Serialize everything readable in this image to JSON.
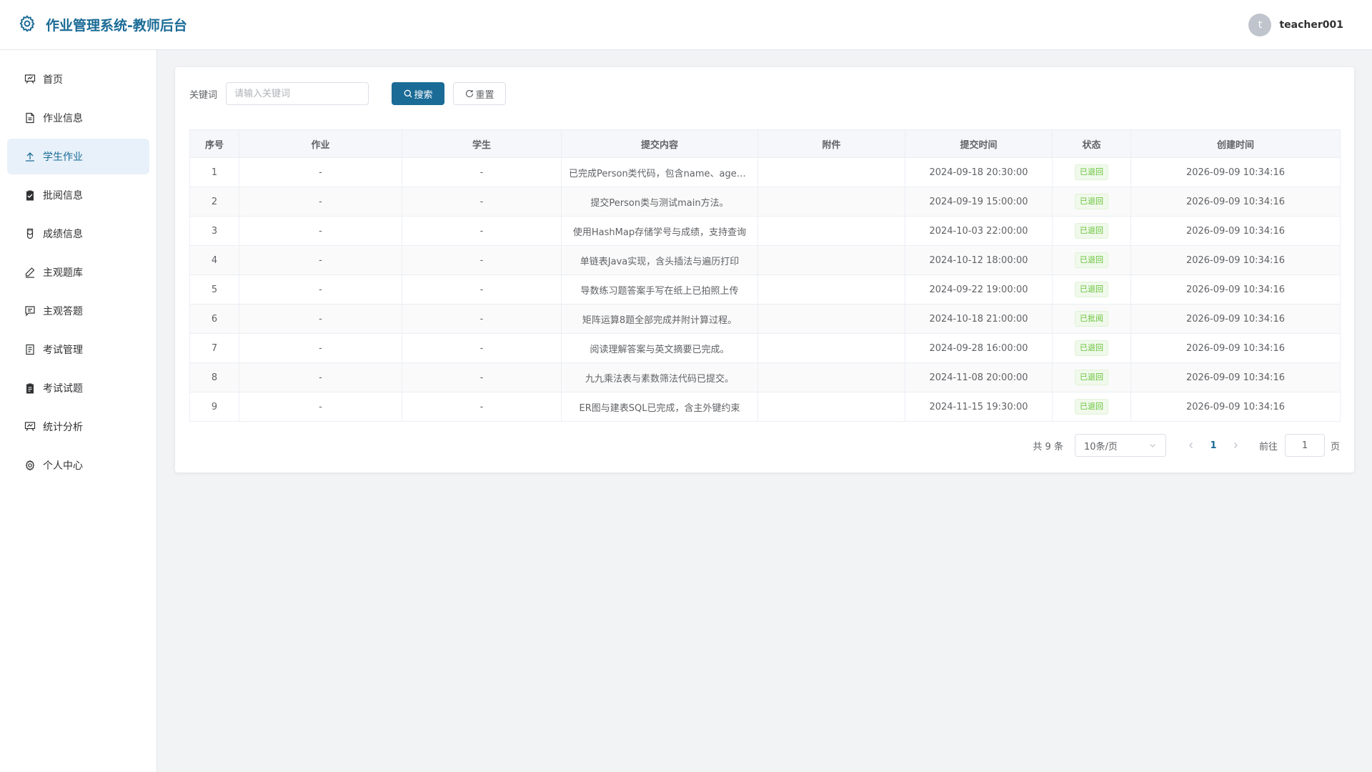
{
  "header": {
    "title": "作业管理系统-教师后台",
    "avatar_initial": "t",
    "username": "teacher001",
    "logo_icon": "gear-icon",
    "brand_color": "#1a6b96"
  },
  "sidebar": {
    "items": [
      {
        "label": "首页",
        "icon": "presentation-icon"
      },
      {
        "label": "作业信息",
        "icon": "document-icon"
      },
      {
        "label": "学生作业",
        "icon": "upload-icon",
        "active": true
      },
      {
        "label": "批阅信息",
        "icon": "clipboard-check-icon"
      },
      {
        "label": "成绩信息",
        "icon": "medal-icon"
      },
      {
        "label": "主观题库",
        "icon": "edit-pen-icon"
      },
      {
        "label": "主观答题",
        "icon": "chat-icon"
      },
      {
        "label": "考试管理",
        "icon": "tickets-icon"
      },
      {
        "label": "考试试题",
        "icon": "clipboard-icon"
      },
      {
        "label": "统计分析",
        "icon": "chart-board-icon"
      },
      {
        "label": "个人中心",
        "icon": "setting-icon"
      }
    ]
  },
  "search": {
    "label": "关键词",
    "placeholder": "请输入关键词",
    "value": "",
    "search_button": "搜索",
    "reset_button": "重置"
  },
  "table": {
    "columns": [
      "序号",
      "作业",
      "学生",
      "提交内容",
      "附件",
      "提交时间",
      "状态",
      "创建时间"
    ],
    "rows": [
      {
        "no": "1",
        "homework": "-",
        "student": "-",
        "content": "已完成Person类代码，包含name、age属性",
        "attachment": "",
        "submit_time": "2024-09-18 20:30:00",
        "status": "已退回",
        "created": "2026-09-09 10:34:16"
      },
      {
        "no": "2",
        "homework": "-",
        "student": "-",
        "content": "提交Person类与测试main方法。",
        "attachment": "",
        "submit_time": "2024-09-19 15:00:00",
        "status": "已退回",
        "created": "2026-09-09 10:34:16"
      },
      {
        "no": "3",
        "homework": "-",
        "student": "-",
        "content": "使用HashMap存储学号与成绩，支持查询",
        "attachment": "",
        "submit_time": "2024-10-03 22:00:00",
        "status": "已退回",
        "created": "2026-09-09 10:34:16"
      },
      {
        "no": "4",
        "homework": "-",
        "student": "-",
        "content": "单链表Java实现，含头插法与遍历打印",
        "attachment": "",
        "submit_time": "2024-10-12 18:00:00",
        "status": "已退回",
        "created": "2026-09-09 10:34:16"
      },
      {
        "no": "5",
        "homework": "-",
        "student": "-",
        "content": "导数练习题答案手写在纸上已拍照上传",
        "attachment": "",
        "submit_time": "2024-09-22 19:00:00",
        "status": "已退回",
        "created": "2026-09-09 10:34:16"
      },
      {
        "no": "6",
        "homework": "-",
        "student": "-",
        "content": "矩阵运算8题全部完成并附计算过程。",
        "attachment": "",
        "submit_time": "2024-10-18 21:00:00",
        "status": "已批阅",
        "created": "2026-09-09 10:34:16"
      },
      {
        "no": "7",
        "homework": "-",
        "student": "-",
        "content": "阅读理解答案与英文摘要已完成。",
        "attachment": "",
        "submit_time": "2024-09-28 16:00:00",
        "status": "已退回",
        "created": "2026-09-09 10:34:16"
      },
      {
        "no": "8",
        "homework": "-",
        "student": "-",
        "content": "九九乘法表与素数筛法代码已提交。",
        "attachment": "",
        "submit_time": "2024-11-08 20:00:00",
        "status": "已退回",
        "created": "2026-09-09 10:34:16"
      },
      {
        "no": "9",
        "homework": "-",
        "student": "-",
        "content": "ER图与建表SQL已完成，含主外键约束",
        "attachment": "",
        "submit_time": "2024-11-15 19:30:00",
        "status": "已退回",
        "created": "2026-09-09 10:34:16"
      }
    ]
  },
  "pagination": {
    "total": "共 9 条",
    "page_size": "10条/页",
    "current_page": "1",
    "goto_label": "前往",
    "goto_value": "1",
    "page_suffix": "页"
  }
}
